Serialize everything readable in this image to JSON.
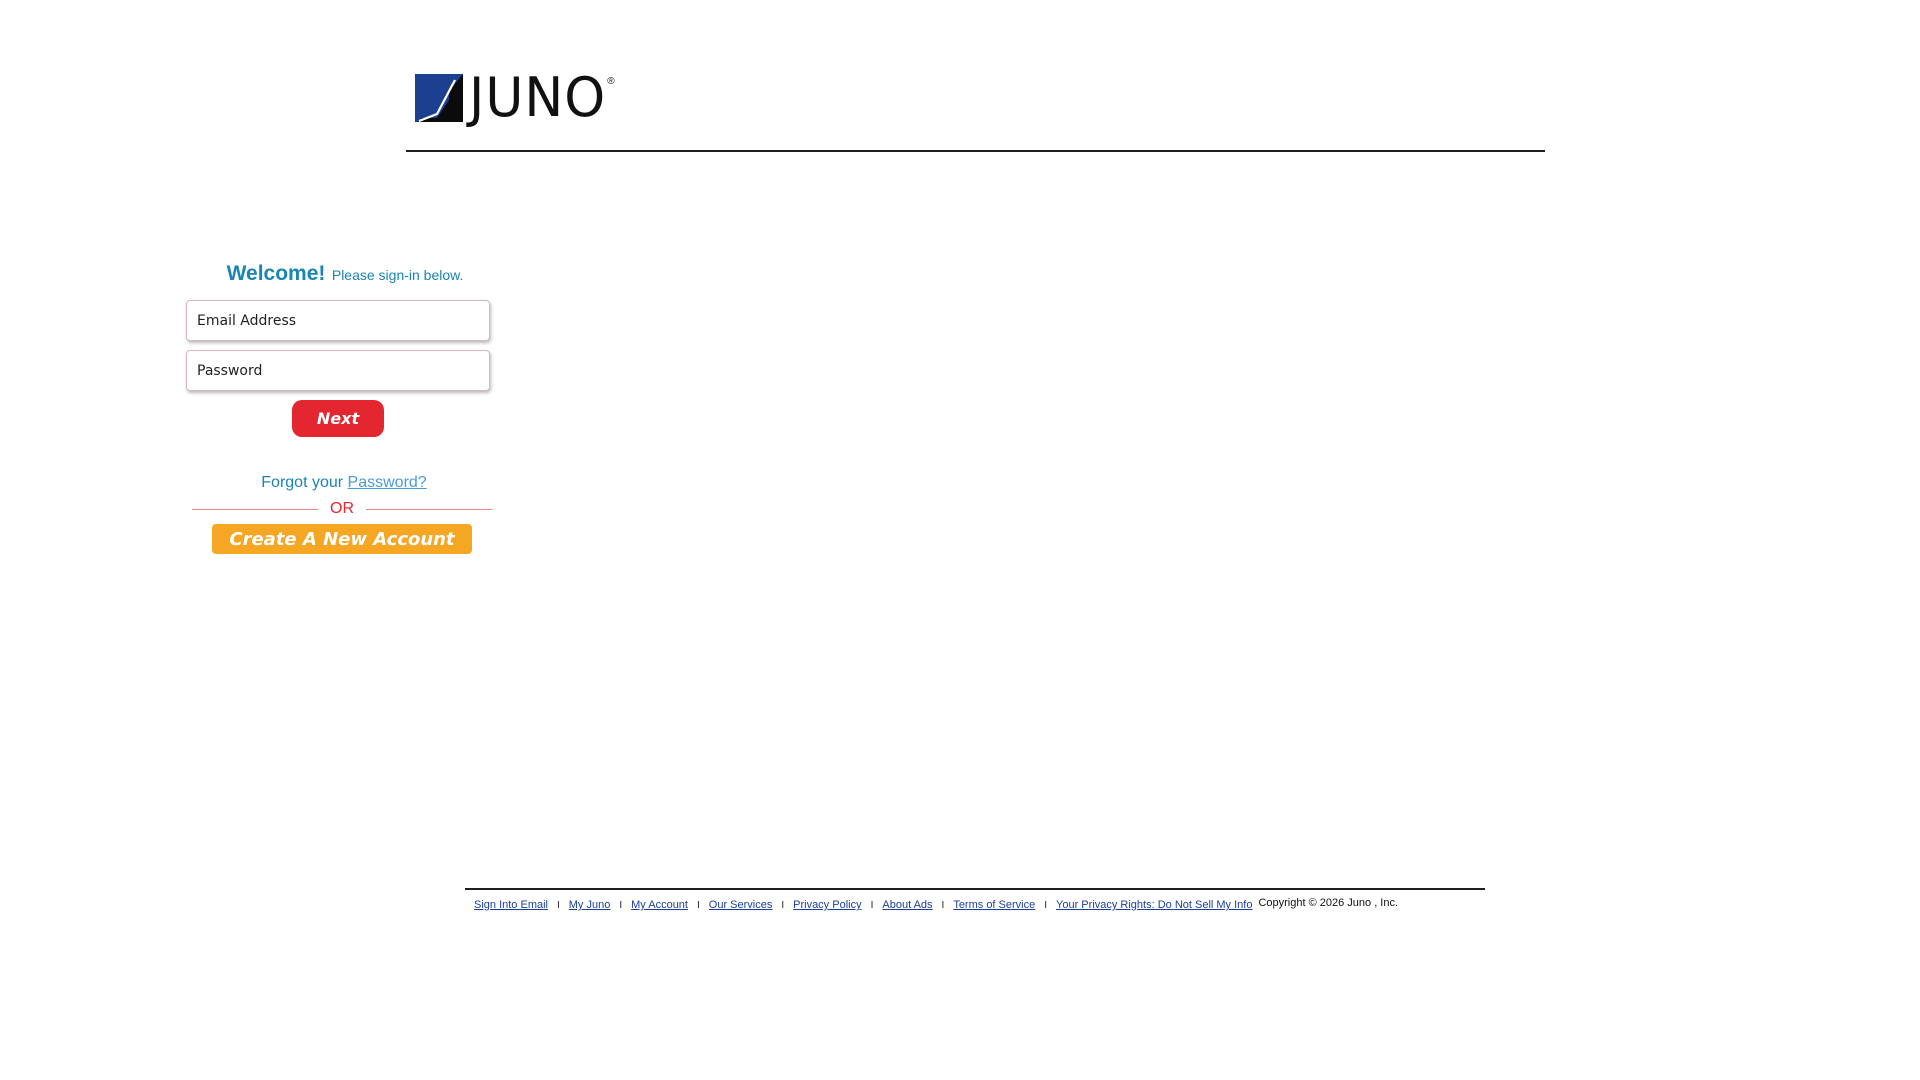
{
  "header": {
    "logo_text": "JUNO",
    "logo_reg": "®"
  },
  "signin": {
    "welcome_strong": "Welcome!",
    "welcome_sub": "Please sign-in below.",
    "email_placeholder": "Email Address",
    "email_value": "",
    "password_placeholder": "Password",
    "password_value": "",
    "next_label": "Next",
    "forgot_prefix": "Forgot your",
    "forgot_link": "Password?",
    "or_label": "OR",
    "create_label": "Create A New Account"
  },
  "footer": {
    "links": [
      "Sign Into Email",
      "My Juno",
      "My Account",
      "Our Services",
      "Privacy Policy",
      "About Ads",
      "Terms of Service",
      "Your Privacy Rights: Do Not Sell My Info"
    ],
    "separator": "I",
    "copyright": "Copyright © 2026 Juno , Inc."
  },
  "colors": {
    "brand_blue": "#1a84b3",
    "next_red": "#e3262f",
    "create_orange": "#f5a623",
    "footer_link": "#1c3e9a"
  }
}
